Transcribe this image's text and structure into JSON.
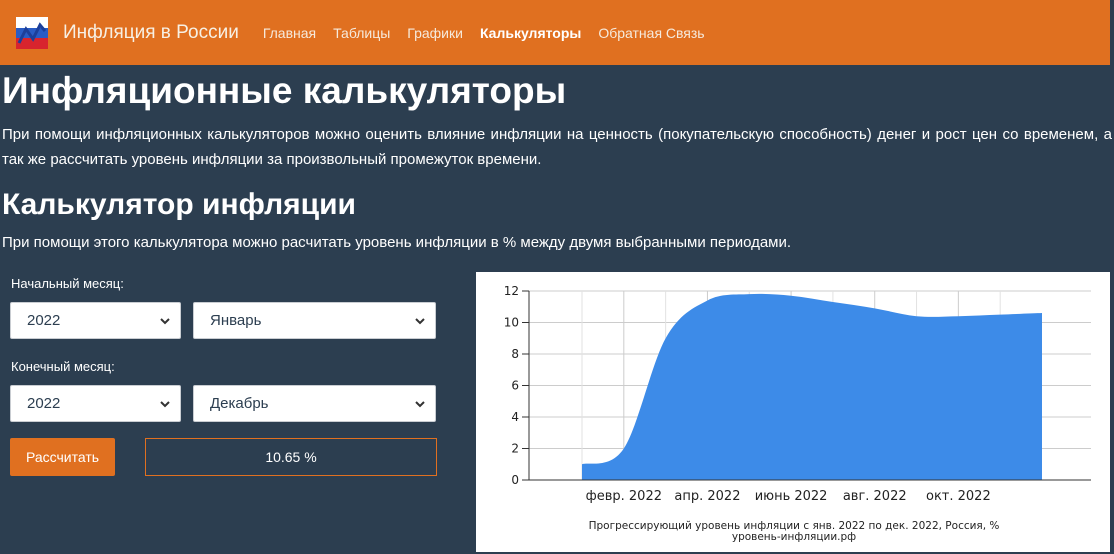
{
  "nav": {
    "brand": "Инфляция в России",
    "items": [
      {
        "label": "Главная",
        "active": false
      },
      {
        "label": "Таблицы",
        "active": false
      },
      {
        "label": "Графики",
        "active": false
      },
      {
        "label": "Калькуляторы",
        "active": true
      },
      {
        "label": "Обратная Связь",
        "active": false
      }
    ]
  },
  "page": {
    "title": "Инфляционные калькуляторы",
    "intro": "При помощи инфляционных калькуляторов можно оценить влияние инфляции на ценность (покупательскую способность) денег и рост цен со временем, а так же рассчитать уровень инфляции за произвольный промежуток времени."
  },
  "calculator": {
    "title": "Калькулятор инфляции",
    "description": "При помощи этого калькулятора можно расчитать уровень инфляции в % между двумя выбранными периодами.",
    "start_label": "Начальный месяц:",
    "start_year": "2022",
    "start_month": "Январь",
    "end_label": "Конечный месяц:",
    "end_year": "2022",
    "end_month": "Декабрь",
    "button_label": "Рассчитать",
    "result": "10.65 %"
  },
  "colors": {
    "accent": "#e07020",
    "background": "#2c3e50",
    "series": "#3d8be8"
  },
  "chart_data": {
    "type": "area",
    "caption_line1": "Прогрессирующий уровень инфляции с янв. 2022 по дек. 2022, Россия, %",
    "caption_line2": "уровень-инфляции.рф",
    "x": [
      "2022-01",
      "2022-02",
      "2022-03",
      "2022-04",
      "2022-05",
      "2022-06",
      "2022-07",
      "2022-08",
      "2022-09",
      "2022-10",
      "2022-11",
      "2022-12"
    ],
    "values": [
      1.0,
      2.0,
      9.0,
      11.4,
      11.8,
      11.7,
      11.3,
      10.9,
      10.4,
      10.4,
      10.5,
      10.6
    ],
    "x_ticks": [
      "февр. 2022",
      "апр. 2022",
      "июнь 2022",
      "авг. 2022",
      "окт. 2022"
    ],
    "y_ticks": [
      "0",
      "2",
      "4",
      "6",
      "8",
      "10",
      "12"
    ],
    "ylim": [
      0,
      12
    ],
    "grid": true,
    "legend": "none"
  }
}
